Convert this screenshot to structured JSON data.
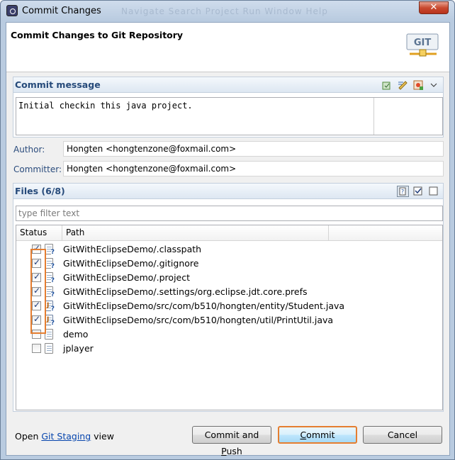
{
  "window": {
    "title": "Commit Changes",
    "ghost_menu": "Navigate  Search  Project  Run  Window  Help"
  },
  "header": {
    "title": "Commit Changes to Git Repository",
    "logo_text": "GIT"
  },
  "commit_message": {
    "section_title": "Commit message",
    "text": "Initial checkin this java project."
  },
  "author": {
    "label": "Author:",
    "value": "Hongten <hongtenzone@foxmail.com>"
  },
  "committer": {
    "label": "Committer:",
    "value": "Hongten <hongtenzone@foxmail.com>"
  },
  "files": {
    "section_title": "Files (6/8)",
    "filter_placeholder": "type filter text",
    "columns": [
      "Status",
      "Path"
    ],
    "rows": [
      {
        "path": "GitWithEclipseDemo/.classpath",
        "checked": true,
        "icon": "file-untracked-icon"
      },
      {
        "path": "GitWithEclipseDemo/.gitignore",
        "checked": true,
        "icon": "file-untracked-icon"
      },
      {
        "path": "GitWithEclipseDemo/.project",
        "checked": true,
        "icon": "file-untracked-icon"
      },
      {
        "path": "GitWithEclipseDemo/.settings/org.eclipse.jdt.core.prefs",
        "checked": true,
        "icon": "file-untracked-icon"
      },
      {
        "path": "GitWithEclipseDemo/src/com/b510/hongten/entity/Student.java",
        "checked": true,
        "icon": "java-file-untracked-icon"
      },
      {
        "path": "GitWithEclipseDemo/src/com/b510/hongten/util/PrintUtil.java",
        "checked": true,
        "icon": "java-file-untracked-icon"
      },
      {
        "path": "demo",
        "checked": false,
        "icon": "file-icon"
      },
      {
        "path": "jplayer",
        "checked": false,
        "icon": "file-icon"
      }
    ]
  },
  "footer": {
    "prefix": "Open ",
    "link": "Git Staging",
    "suffix": " view"
  },
  "buttons": {
    "commit_and_push": "Commit and Push",
    "commit": "Commit",
    "cancel": "Cancel"
  },
  "colors": {
    "accent_highlight": "#e57e30",
    "section_title": "#264a7a",
    "link": "#0645ad"
  }
}
